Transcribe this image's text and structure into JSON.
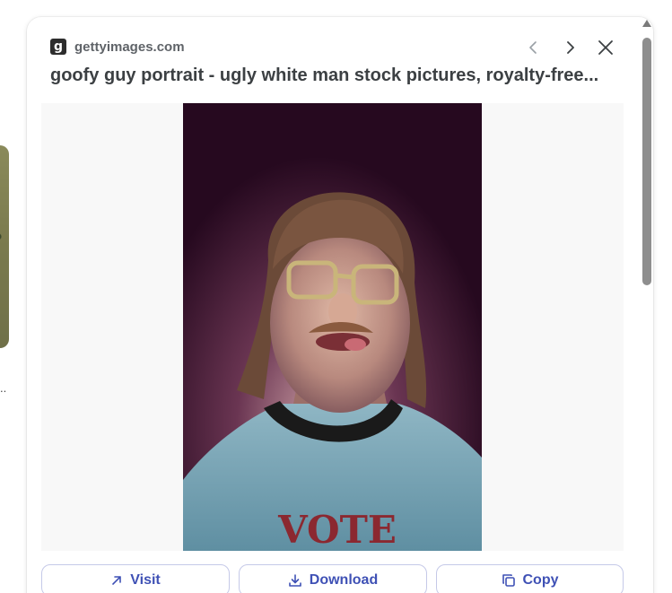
{
  "background": {
    "ellipsis": ".."
  },
  "source": {
    "logo_letter": "g",
    "domain": "gettyimages.com"
  },
  "nav": {
    "prev_icon": "chevron-left-icon",
    "next_icon": "chevron-right-icon",
    "close_icon": "close-icon"
  },
  "title": "goofy guy portrait - ugly white man stock pictures, royalty-free...",
  "image": {
    "shirt_text": "VOTE"
  },
  "actions": {
    "visit": "Visit",
    "download": "Download",
    "copy": "Copy"
  },
  "colors": {
    "accent": "#3f51b5",
    "button_border": "#c5c9e8",
    "title": "#3c4043"
  }
}
